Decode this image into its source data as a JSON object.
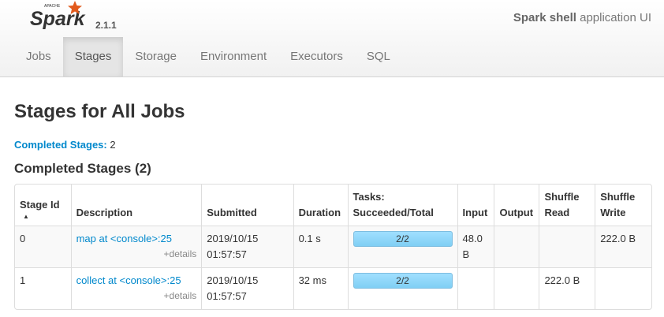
{
  "header": {
    "brand_top": "APACHE",
    "brand": "Spark",
    "version": "2.1.1",
    "app_name": "Spark shell",
    "app_suffix": " application UI"
  },
  "tabs": [
    {
      "label": "Jobs",
      "active": false
    },
    {
      "label": "Stages",
      "active": true
    },
    {
      "label": "Storage",
      "active": false
    },
    {
      "label": "Environment",
      "active": false
    },
    {
      "label": "Executors",
      "active": false
    },
    {
      "label": "SQL",
      "active": false
    }
  ],
  "page": {
    "title": "Stages for All Jobs",
    "summary_label": "Completed Stages:",
    "summary_value": " 2",
    "section_title": "Completed Stages (2)"
  },
  "table": {
    "headers": {
      "stage_id": "Stage Id",
      "description": "Description",
      "submitted": "Submitted",
      "duration": "Duration",
      "tasks_line1": "Tasks:",
      "tasks_line2": "Succeeded/Total",
      "input": "Input",
      "output": "Output",
      "shuffle_read_1": "Shuffle",
      "shuffle_read_2": "Read",
      "shuffle_write_1": "Shuffle",
      "shuffle_write_2": "Write"
    },
    "sort_indicator": "▲",
    "details_label": "+details",
    "rows": [
      {
        "stage_id": "0",
        "description": "map at <console>:25",
        "submitted_date": "2019/10/15",
        "submitted_time": "01:57:57",
        "duration": "0.1 s",
        "tasks": "2/2",
        "tasks_fraction": 1.0,
        "input_1": "48.0",
        "input_2": "B",
        "output": "",
        "shuffle_read": "",
        "shuffle_write": "222.0 B"
      },
      {
        "stage_id": "1",
        "description": "collect at <console>:25",
        "submitted_date": "2019/10/15",
        "submitted_time": "01:57:57",
        "duration": "32 ms",
        "tasks": "2/2",
        "tasks_fraction": 1.0,
        "input_1": "",
        "input_2": "",
        "output": "",
        "shuffle_read": "222.0 B",
        "shuffle_write": ""
      }
    ]
  },
  "colors": {
    "link": "#0088cc",
    "spark_orange": "#e25a1c",
    "progress_fill": "#a0dfff"
  }
}
